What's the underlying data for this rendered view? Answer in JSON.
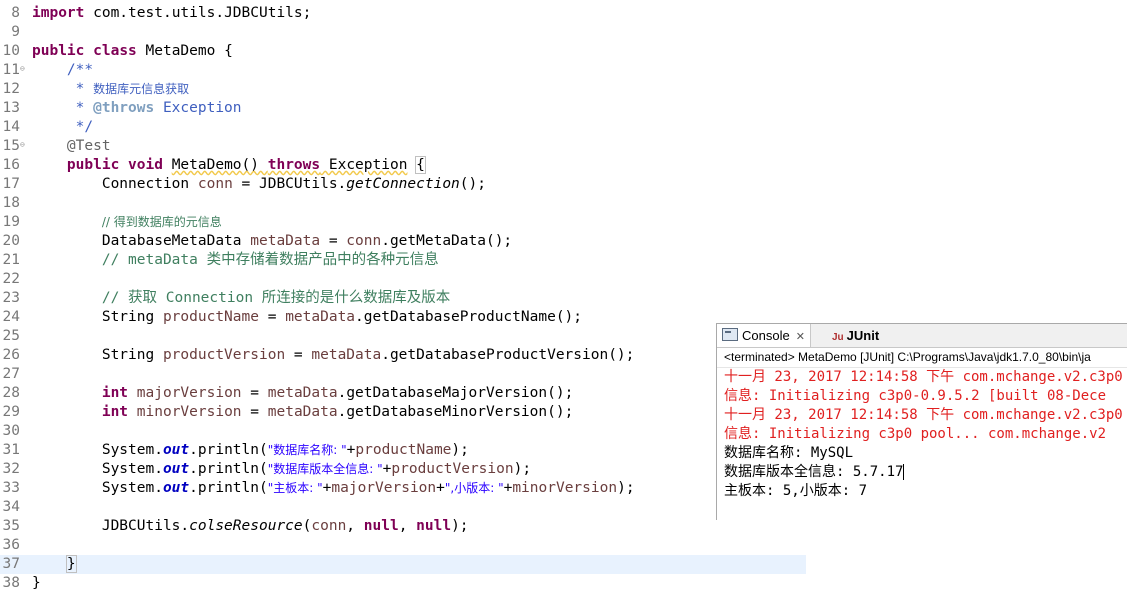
{
  "editor": {
    "lines": [
      {
        "n": "8"
      },
      {
        "n": "9"
      },
      {
        "n": "10"
      },
      {
        "n": "11"
      },
      {
        "n": "12",
        "text": "数据库元信息获取"
      },
      {
        "n": "13",
        "tag": "@throws",
        "text": "Exception"
      },
      {
        "n": "14"
      },
      {
        "n": "15",
        "text": "@Test"
      },
      {
        "n": "16"
      },
      {
        "n": "17"
      },
      {
        "n": "18"
      },
      {
        "n": "19",
        "text": "// 得到数据库的元信息"
      },
      {
        "n": "20"
      },
      {
        "n": "21",
        "text": "// metaData 类中存储着数据产品中的各种元信息"
      },
      {
        "n": "22"
      },
      {
        "n": "23",
        "text": "// 获取 Connection 所连接的是什么数据库及版本"
      },
      {
        "n": "24"
      },
      {
        "n": "25"
      },
      {
        "n": "26"
      },
      {
        "n": "27"
      },
      {
        "n": "28"
      },
      {
        "n": "29"
      },
      {
        "n": "30"
      },
      {
        "n": "31",
        "s1": "\"数据库名称: \""
      },
      {
        "n": "32",
        "s1": "\"数据库版本全信息: \""
      },
      {
        "n": "33",
        "s1": "\"主板本: \"",
        "s2": "\",小版本: \""
      },
      {
        "n": "34"
      },
      {
        "n": "35"
      },
      {
        "n": "36"
      },
      {
        "n": "37"
      },
      {
        "n": "38"
      }
    ]
  },
  "console": {
    "tab_console": "Console",
    "tab_junit": "JUnit",
    "status": "<terminated> MetaDemo [JUnit] C:\\Programs\\Java\\jdk1.7.0_80\\bin\\ja",
    "lines": [
      "十一月 23, 2017 12:14:58 下午 com.mchange.v2.c3p0",
      "信息: Initializing c3p0-0.9.5.2 [built 08-Dece",
      "十一月 23, 2017 12:14:58 下午 com.mchange.v2.c3p0",
      "信息: Initializing c3p0 pool... com.mchange.v2",
      "数据库名称: MySQL",
      "数据库版本全信息: 5.7.17",
      "主板本: 5,小版本: 7"
    ]
  }
}
